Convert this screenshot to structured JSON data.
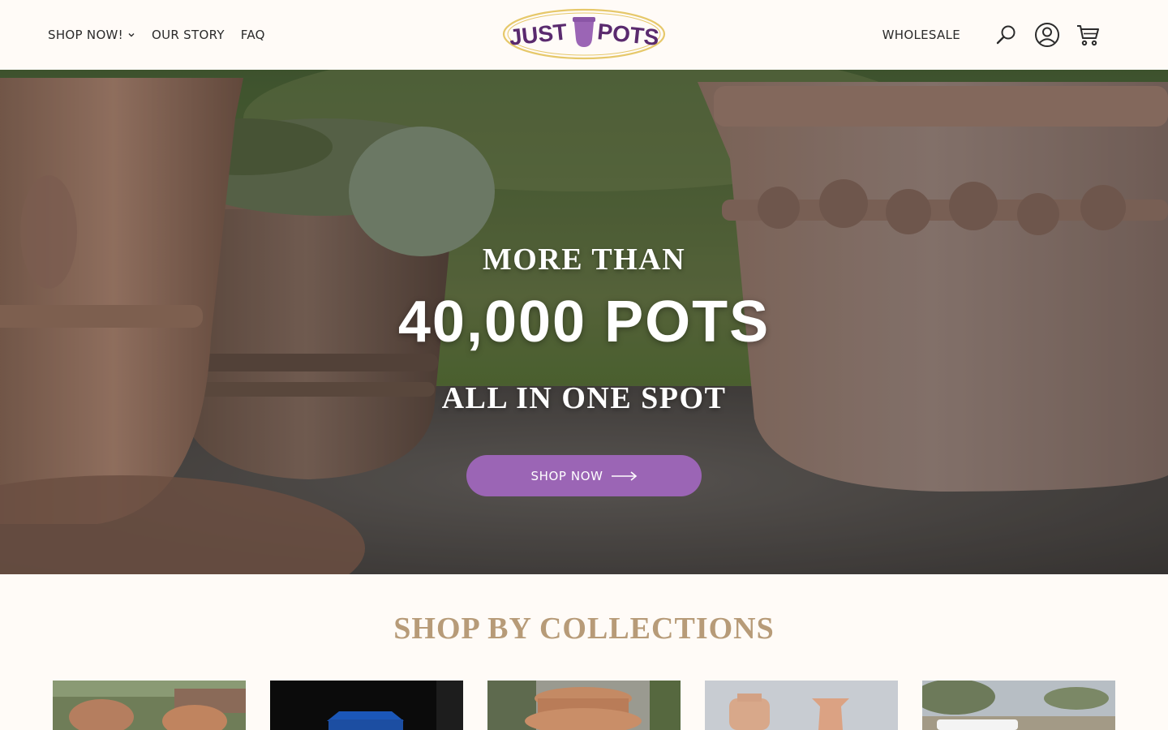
{
  "header": {
    "nav_left": [
      {
        "label": "SHOP NOW!",
        "has_dropdown": true
      },
      {
        "label": "OUR STORY"
      },
      {
        "label": "FAQ"
      }
    ],
    "logo_text_left": "JUST",
    "logo_text_right": "POTS",
    "wholesale_label": "WHOLESALE",
    "icons": [
      "search-icon",
      "account-icon",
      "cart-icon"
    ]
  },
  "hero": {
    "eyebrow": "MORE THAN",
    "headline": "40,000 POTS",
    "subline": "ALL IN ONE SPOT",
    "cta_label": "SHOP NOW"
  },
  "collections": {
    "title": "SHOP BY COLLECTIONS",
    "tiles": 5
  },
  "colors": {
    "background": "#fffbf7",
    "accent_purple": "#9b65b5",
    "logo_purple": "#5a2a6e",
    "logo_gold": "#e6c86a",
    "title_tan": "#b79b78"
  }
}
